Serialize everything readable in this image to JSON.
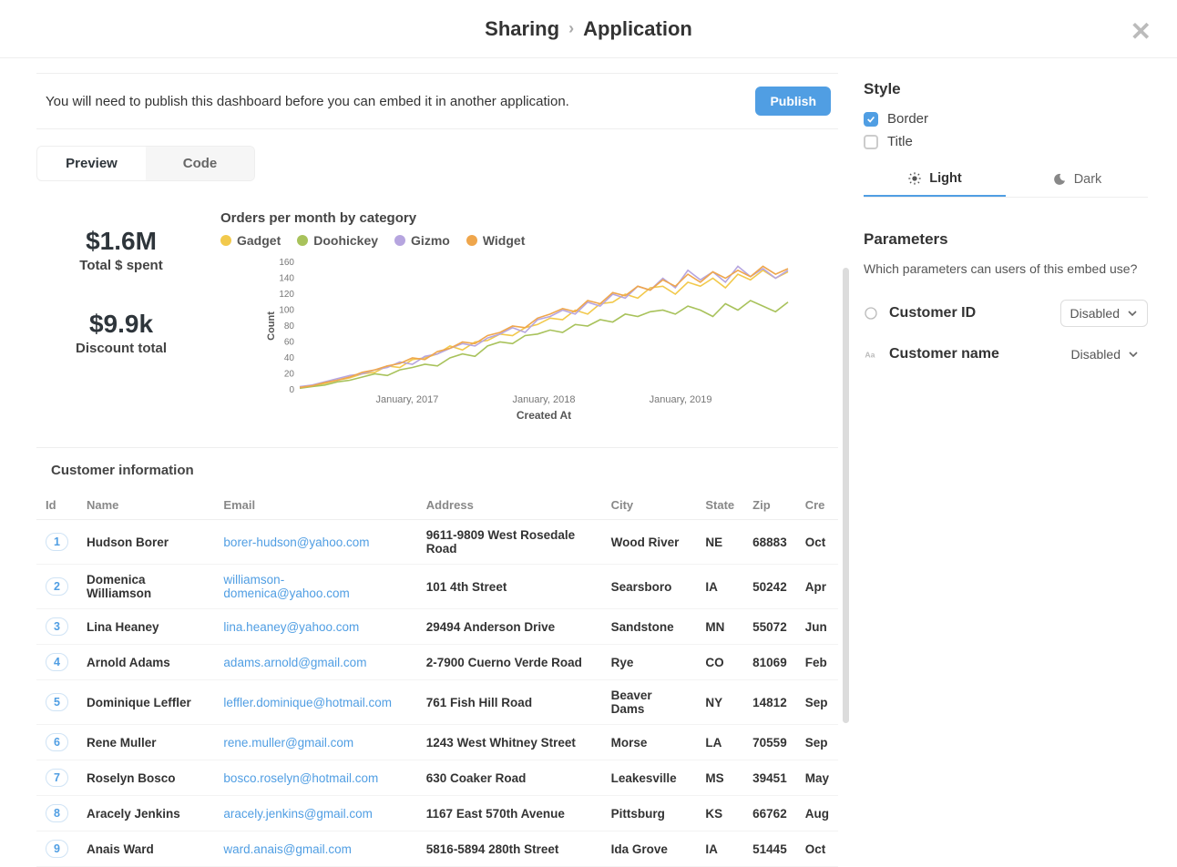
{
  "header": {
    "crumb1": "Sharing",
    "crumb2": "Application",
    "close": "✕"
  },
  "notice": {
    "text": "You will need to publish this dashboard before you can embed it in another application.",
    "publish": "Publish"
  },
  "tabs": {
    "preview": "Preview",
    "code": "Code"
  },
  "metrics": {
    "spent_value": "$1.6M",
    "spent_label": "Total $ spent",
    "discount_value": "$9.9k",
    "discount_label": "Discount total"
  },
  "chart_data": {
    "type": "line",
    "title": "Orders per month by category",
    "ylabel": "Count",
    "xlabel": "Created At",
    "ylim": [
      0,
      160
    ],
    "y_ticks": [
      0,
      20,
      40,
      60,
      80,
      100,
      120,
      140,
      160
    ],
    "x_ticks": [
      "January, 2017",
      "January, 2018",
      "January, 2019"
    ],
    "legend": [
      {
        "name": "Gadget",
        "color": "#F2C94C"
      },
      {
        "name": "Doohickey",
        "color": "#A8C25B"
      },
      {
        "name": "Gizmo",
        "color": "#B6A5DF"
      },
      {
        "name": "Widget",
        "color": "#EFA64C"
      }
    ],
    "x": [
      0,
      1,
      2,
      3,
      4,
      5,
      6,
      7,
      8,
      9,
      10,
      11,
      12,
      13,
      14,
      15,
      16,
      17,
      18,
      19,
      20,
      21,
      22,
      23,
      24,
      25,
      26,
      27,
      28,
      29,
      30,
      31,
      32,
      33,
      34,
      35,
      36,
      37,
      38,
      39
    ],
    "series": [
      {
        "name": "Gadget",
        "color": "#F2C94C",
        "values": [
          3,
          5,
          8,
          12,
          15,
          20,
          22,
          30,
          28,
          38,
          40,
          45,
          55,
          50,
          60,
          62,
          70,
          68,
          78,
          82,
          90,
          88,
          100,
          95,
          108,
          110,
          120,
          115,
          128,
          130,
          120,
          135,
          130,
          140,
          128,
          145,
          138,
          150,
          140,
          148
        ]
      },
      {
        "name": "Doohickey",
        "color": "#A8C25B",
        "values": [
          2,
          4,
          6,
          10,
          12,
          16,
          20,
          18,
          25,
          28,
          32,
          30,
          40,
          45,
          42,
          55,
          60,
          58,
          68,
          70,
          75,
          72,
          82,
          80,
          88,
          85,
          95,
          92,
          98,
          100,
          95,
          105,
          100,
          92,
          108,
          100,
          112,
          105,
          98,
          110
        ]
      },
      {
        "name": "Gizmo",
        "color": "#B6A5DF",
        "values": [
          4,
          6,
          10,
          14,
          18,
          20,
          25,
          28,
          35,
          32,
          42,
          45,
          52,
          58,
          55,
          65,
          70,
          78,
          72,
          88,
          92,
          100,
          95,
          110,
          105,
          120,
          115,
          130,
          125,
          140,
          128,
          150,
          138,
          148,
          135,
          155,
          142,
          152,
          140,
          150
        ]
      },
      {
        "name": "Widget",
        "color": "#EFA64C",
        "values": [
          3,
          5,
          9,
          12,
          16,
          22,
          25,
          30,
          33,
          40,
          38,
          48,
          52,
          60,
          58,
          68,
          72,
          80,
          78,
          90,
          95,
          102,
          98,
          112,
          108,
          122,
          118,
          130,
          125,
          138,
          130,
          145,
          135,
          148,
          140,
          150,
          142,
          155,
          145,
          152
        ]
      }
    ]
  },
  "table": {
    "title": "Customer information",
    "columns": [
      "Id",
      "Name",
      "Email",
      "Address",
      "City",
      "State",
      "Zip",
      "Cre"
    ],
    "rows": [
      {
        "id": "1",
        "name": "Hudson Borer",
        "email": "borer-hudson@yahoo.com",
        "address": "9611-9809 West Rosedale Road",
        "city": "Wood River",
        "state": "NE",
        "zip": "68883",
        "cre": "Oct"
      },
      {
        "id": "2",
        "name": "Domenica Williamson",
        "email": "williamson-domenica@yahoo.com",
        "address": "101 4th Street",
        "city": "Searsboro",
        "state": "IA",
        "zip": "50242",
        "cre": "Apr"
      },
      {
        "id": "3",
        "name": "Lina Heaney",
        "email": "lina.heaney@yahoo.com",
        "address": "29494 Anderson Drive",
        "city": "Sandstone",
        "state": "MN",
        "zip": "55072",
        "cre": "Jun"
      },
      {
        "id": "4",
        "name": "Arnold Adams",
        "email": "adams.arnold@gmail.com",
        "address": "2-7900 Cuerno Verde Road",
        "city": "Rye",
        "state": "CO",
        "zip": "81069",
        "cre": "Feb"
      },
      {
        "id": "5",
        "name": "Dominique Leffler",
        "email": "leffler.dominique@hotmail.com",
        "address": "761 Fish Hill Road",
        "city": "Beaver Dams",
        "state": "NY",
        "zip": "14812",
        "cre": "Sep"
      },
      {
        "id": "6",
        "name": "Rene Muller",
        "email": "rene.muller@gmail.com",
        "address": "1243 West Whitney Street",
        "city": "Morse",
        "state": "LA",
        "zip": "70559",
        "cre": "Sep"
      },
      {
        "id": "7",
        "name": "Roselyn Bosco",
        "email": "bosco.roselyn@hotmail.com",
        "address": "630 Coaker Road",
        "city": "Leakesville",
        "state": "MS",
        "zip": "39451",
        "cre": "May"
      },
      {
        "id": "8",
        "name": "Aracely Jenkins",
        "email": "aracely.jenkins@gmail.com",
        "address": "1167 East 570th Avenue",
        "city": "Pittsburg",
        "state": "KS",
        "zip": "66762",
        "cre": "Aug"
      },
      {
        "id": "9",
        "name": "Anais Ward",
        "email": "ward.anais@gmail.com",
        "address": "5816-5894 280th Street",
        "city": "Ida Grove",
        "state": "IA",
        "zip": "51445",
        "cre": "Oct"
      }
    ]
  },
  "style_panel": {
    "title": "Style",
    "border_label": "Border",
    "title_label": "Title",
    "light": "Light",
    "dark": "Dark"
  },
  "parameters_panel": {
    "title": "Parameters",
    "desc": "Which parameters can users of this embed use?",
    "items": [
      {
        "name": "Customer ID",
        "value": "Disabled"
      },
      {
        "name": "Customer name",
        "value": "Disabled"
      }
    ]
  }
}
